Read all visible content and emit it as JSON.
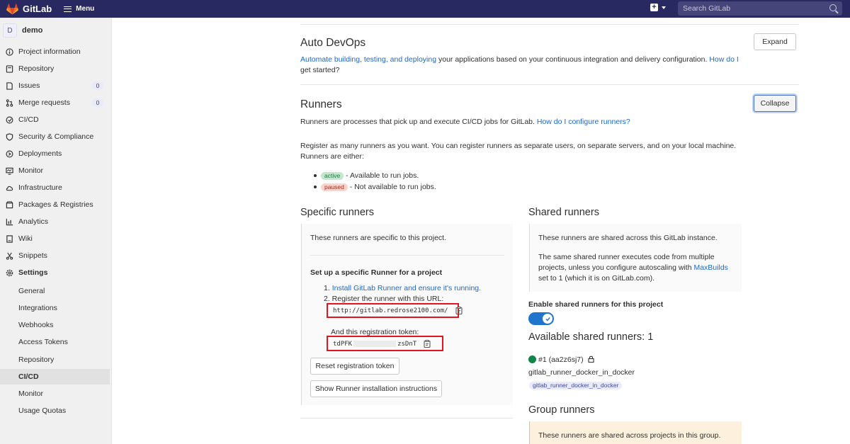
{
  "topbar": {
    "brand": "GitLab",
    "menu_label": "Menu",
    "search_placeholder": "Search GitLab"
  },
  "sidebar": {
    "project_initial": "D",
    "project_name": "demo",
    "items": [
      {
        "label": "Project information",
        "icon": "info-icon"
      },
      {
        "label": "Repository",
        "icon": "book-icon"
      },
      {
        "label": "Issues",
        "icon": "issues-icon",
        "count": "0"
      },
      {
        "label": "Merge requests",
        "icon": "merge-request-icon",
        "count": "0"
      },
      {
        "label": "CI/CD",
        "icon": "rocket-icon"
      },
      {
        "label": "Security & Compliance",
        "icon": "shield-icon"
      },
      {
        "label": "Deployments",
        "icon": "deployments-icon"
      },
      {
        "label": "Monitor",
        "icon": "monitor-icon"
      },
      {
        "label": "Infrastructure",
        "icon": "cloud-icon"
      },
      {
        "label": "Packages & Registries",
        "icon": "package-icon"
      },
      {
        "label": "Analytics",
        "icon": "chart-icon"
      },
      {
        "label": "Wiki",
        "icon": "wiki-icon"
      },
      {
        "label": "Snippets",
        "icon": "scissors-icon"
      },
      {
        "label": "Settings",
        "icon": "gear-icon"
      }
    ],
    "settings_sub": [
      "General",
      "Integrations",
      "Webhooks",
      "Access Tokens",
      "Repository",
      "CI/CD",
      "Monitor",
      "Usage Quotas"
    ]
  },
  "autodevops": {
    "title": "Auto DevOps",
    "expand_label": "Expand",
    "desc_link": "Automate building, testing, and deploying",
    "desc_text": " your applications based on your continuous integration and delivery configuration. ",
    "help_link_1": "How do I",
    "help_link_2": "get started?"
  },
  "runners": {
    "title": "Runners",
    "collapse_label": "Collapse",
    "intro": "Runners are processes that pick up and execute CI/CD jobs for GitLab. ",
    "intro_link": "How do I configure runners?",
    "register_line_1": "Register as many runners as you want. You can register runners as separate users, on separate servers, and on your local machine.",
    "register_line_2": "Runners are either:",
    "active_pill": "active",
    "active_text": " - Available to run jobs.",
    "paused_pill": "paused",
    "paused_text": " - Not available to run jobs."
  },
  "specific": {
    "title": "Specific runners",
    "desc": "These runners are specific to this project.",
    "setup_title": "Set up a specific Runner for a project",
    "step1_prefix": "1. ",
    "step1_link": "Install GitLab Runner and ensure it's running.",
    "step2": "2. Register the runner with this URL:",
    "url": "http://gitlab.redrose2100.com/",
    "token_label": "And this registration token:",
    "token_start": "tdPFK",
    "token_end": "zsDnT",
    "reset_label": "Reset registration token",
    "show_label": "Show Runner installation instructions"
  },
  "shared": {
    "title": "Shared runners",
    "desc1": "These runners are shared across this GitLab instance.",
    "desc2_a": "The same shared runner executes code from multiple",
    "desc2_b": "projects, unless you configure autoscaling with ",
    "desc2_link": "MaxBuilds",
    "desc2_c": "set to 1 (which it is on GitLab.com).",
    "enable_label": "Enable shared runners for this project",
    "available_title": "Available shared runners: 1",
    "runner_id": "#1 (aa2z6sj7)",
    "runner_name": "gitlab_runner_docker_in_docker",
    "runner_tag": "gitlab_runner_docker_in_docker"
  },
  "group": {
    "title": "Group runners",
    "desc": "These runners are shared across projects in this group."
  }
}
